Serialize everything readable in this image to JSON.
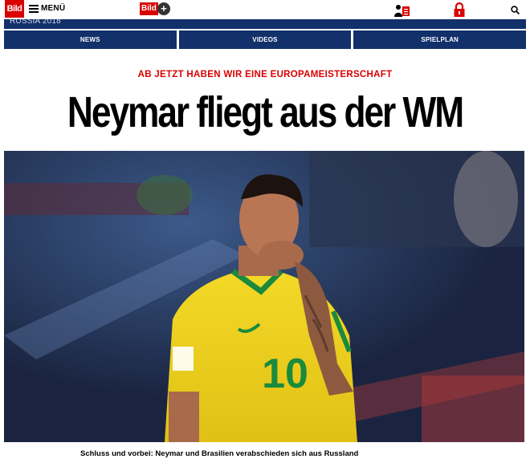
{
  "header": {
    "logo_text": "Bild",
    "menu_label": "MENÜ",
    "bildplus_text": "Bild",
    "bildplus_plus": "+",
    "icons": [
      "user-news-icon",
      "lock-icon",
      "search-icon"
    ]
  },
  "banner": {
    "label": "RUSSIA 2018"
  },
  "nav": {
    "items": [
      {
        "label": "NEWS"
      },
      {
        "label": "VIDEOS"
      },
      {
        "label": "SPIELPLAN"
      }
    ]
  },
  "article": {
    "kicker": "AB JETZT HABEN WIR EINE EUROPAMEISTERSCHAFT",
    "headline": "Neymar fliegt aus der WM",
    "caption": "Schluss und vorbei: Neymar und Brasilien verabschieden sich aus Russland",
    "jersey_number": "10"
  },
  "colors": {
    "brand_red": "#d90000",
    "nav_blue": "#12306a",
    "jersey_yellow": "#f2d21b",
    "jersey_green": "#1b8a3c"
  }
}
